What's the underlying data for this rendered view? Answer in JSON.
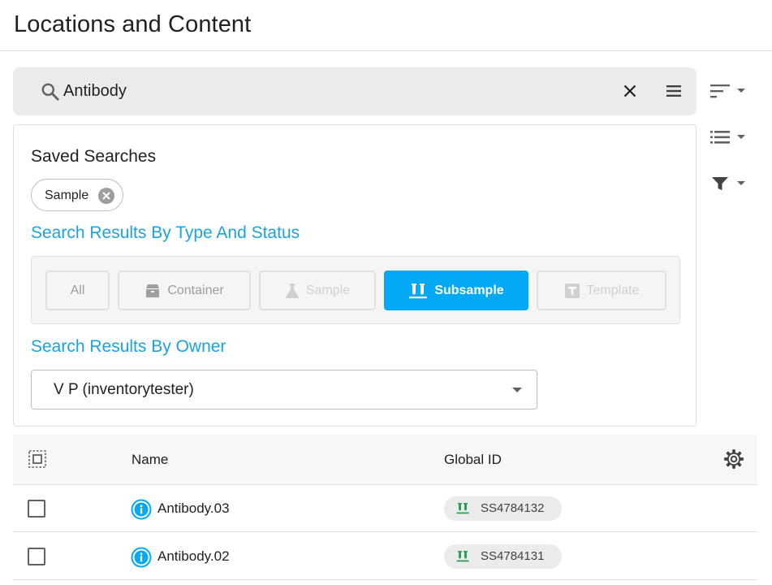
{
  "page": {
    "title": "Locations and Content"
  },
  "search": {
    "query": "Antibody",
    "icon": "search-icon",
    "clear_icon": "close-icon",
    "menu_icon": "menu-icon"
  },
  "side_tools": [
    {
      "name": "sort",
      "icon": "sort-icon"
    },
    {
      "name": "view-list",
      "icon": "list-icon"
    },
    {
      "name": "filter",
      "icon": "filter-icon"
    }
  ],
  "saved_searches": {
    "title": "Saved Searches",
    "chips": [
      {
        "label": "Sample"
      }
    ]
  },
  "type_filter": {
    "title": "Search Results By Type And Status",
    "options": [
      {
        "label": "All",
        "icon": "",
        "state": "enabled"
      },
      {
        "label": "Container",
        "icon": "box-icon",
        "state": "enabled"
      },
      {
        "label": "Sample",
        "icon": "flask-icon",
        "state": "disabled"
      },
      {
        "label": "Subsample",
        "icon": "test-tubes-icon",
        "state": "selected"
      },
      {
        "label": "Template",
        "icon": "template-icon",
        "state": "disabled"
      }
    ]
  },
  "owner_filter": {
    "title": "Search Results By Owner",
    "selected": "V P (inventorytester)"
  },
  "table": {
    "columns": [
      "Name",
      "Global ID"
    ],
    "rows": [
      {
        "name": "Antibody.03",
        "global_id": "SS4784132"
      },
      {
        "name": "Antibody.02",
        "global_id": "SS4784131"
      }
    ]
  },
  "colors": {
    "accent": "#03a9f4",
    "section_title": "#1aa3e0",
    "subsample_icon": "#2e9e5b",
    "info_icon": "#03a9f4"
  }
}
